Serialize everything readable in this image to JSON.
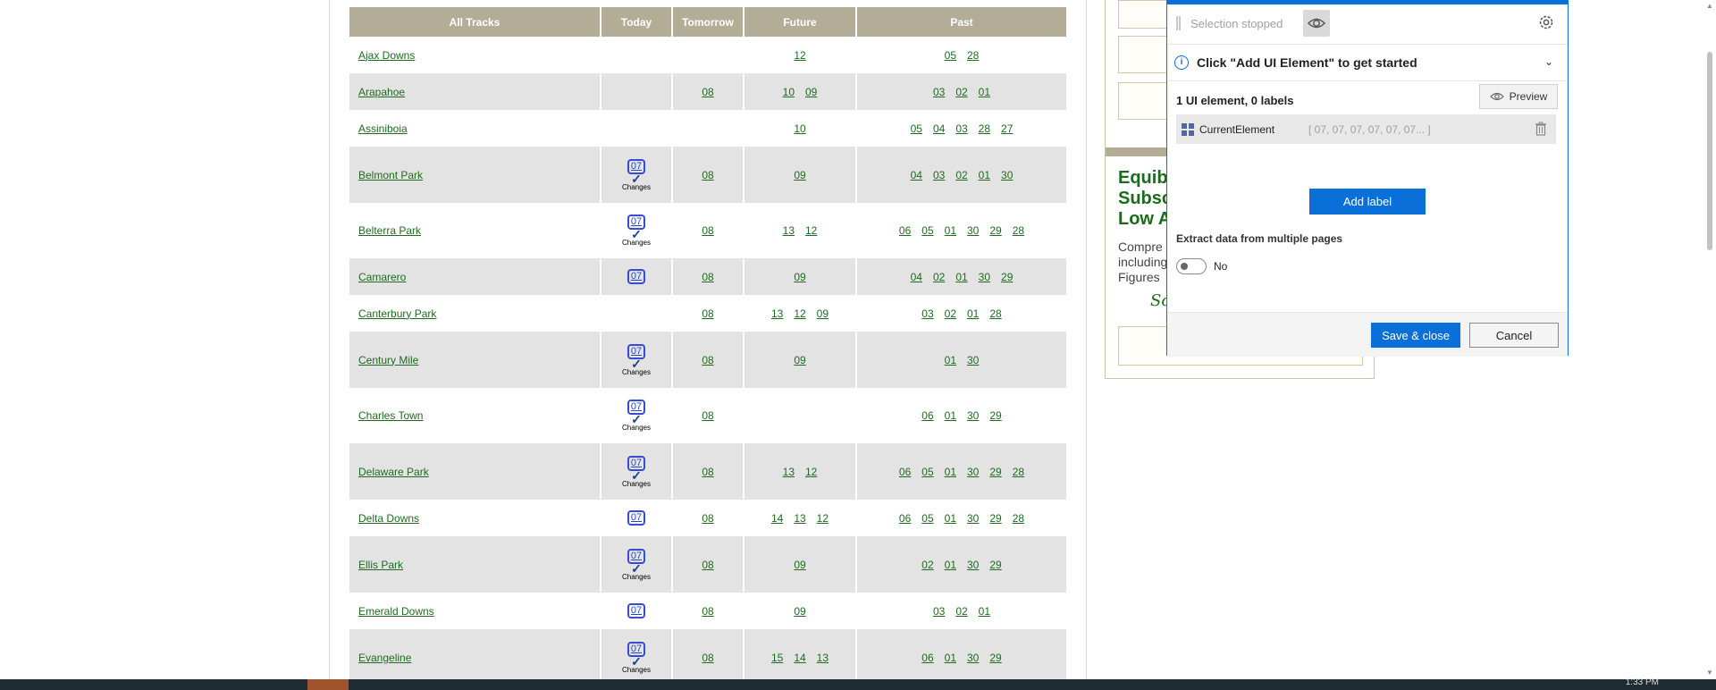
{
  "table": {
    "headers": [
      "All Tracks",
      "Today",
      "Tomorrow",
      "Future",
      "Past"
    ],
    "rows": [
      {
        "track": "Ajax Downs",
        "today": "",
        "today_changes": false,
        "tomorrow": [],
        "future": [
          "12"
        ],
        "past": [
          "05",
          "28"
        ],
        "height": 41,
        "shade": false
      },
      {
        "track": "Arapahoe",
        "today": "",
        "today_changes": false,
        "tomorrow": [
          "08"
        ],
        "future": [
          "10",
          "09"
        ],
        "past": [
          "03",
          "02",
          "01"
        ],
        "height": 41,
        "shade": true
      },
      {
        "track": "Assiniboia",
        "today": "",
        "today_changes": false,
        "tomorrow": [],
        "future": [
          "10"
        ],
        "past": [
          "05",
          "04",
          "03",
          "28",
          "27"
        ],
        "height": 41,
        "shade": false
      },
      {
        "track": "Belmont Park",
        "today": "07",
        "today_changes": true,
        "tomorrow": [
          "08"
        ],
        "future": [
          "09"
        ],
        "past": [
          "04",
          "03",
          "02",
          "01",
          "30"
        ],
        "height": 63,
        "shade": true
      },
      {
        "track": "Belterra Park",
        "today": "07",
        "today_changes": true,
        "tomorrow": [
          "08"
        ],
        "future": [
          "13",
          "12"
        ],
        "past": [
          "06",
          "05",
          "01",
          "30",
          "29",
          "28"
        ],
        "height": 62,
        "shade": false
      },
      {
        "track": "Camarero",
        "today": "07",
        "today_changes": false,
        "tomorrow": [
          "08"
        ],
        "future": [
          "09"
        ],
        "past": [
          "04",
          "02",
          "01",
          "30",
          "29"
        ],
        "height": 41,
        "shade": true
      },
      {
        "track": "Canterbury Park",
        "today": "",
        "today_changes": false,
        "tomorrow": [
          "08"
        ],
        "future": [
          "13",
          "12",
          "09"
        ],
        "past": [
          "03",
          "02",
          "01",
          "28"
        ],
        "height": 41,
        "shade": false
      },
      {
        "track": "Century Mile",
        "today": "07",
        "today_changes": true,
        "tomorrow": [
          "08"
        ],
        "future": [
          "09"
        ],
        "past": [
          "01",
          "30"
        ],
        "height": 63,
        "shade": true
      },
      {
        "track": "Charles Town",
        "today": "07",
        "today_changes": true,
        "tomorrow": [
          "08"
        ],
        "future": [],
        "past": [
          "06",
          "01",
          "30",
          "29"
        ],
        "height": 62,
        "shade": false
      },
      {
        "track": "Delaware Park",
        "today": "07",
        "today_changes": true,
        "tomorrow": [
          "08"
        ],
        "future": [
          "13",
          "12"
        ],
        "past": [
          "06",
          "05",
          "01",
          "30",
          "29",
          "28"
        ],
        "height": 63,
        "shade": true
      },
      {
        "track": "Delta Downs",
        "today": "07",
        "today_changes": false,
        "tomorrow": [
          "08"
        ],
        "future": [
          "14",
          "13",
          "12"
        ],
        "past": [
          "06",
          "05",
          "01",
          "30",
          "29",
          "28"
        ],
        "height": 41,
        "shade": false
      },
      {
        "track": "Ellis Park",
        "today": "07",
        "today_changes": true,
        "tomorrow": [
          "08"
        ],
        "future": [
          "09"
        ],
        "past": [
          "02",
          "01",
          "30",
          "29"
        ],
        "height": 63,
        "shade": true
      },
      {
        "track": "Emerald Downs",
        "today": "07",
        "today_changes": false,
        "tomorrow": [
          "08"
        ],
        "future": [
          "09"
        ],
        "past": [
          "03",
          "02",
          "01"
        ],
        "height": 41,
        "shade": false
      },
      {
        "track": "Evangeline",
        "today": "07",
        "today_changes": true,
        "tomorrow": [
          "08"
        ],
        "future": [
          "15",
          "14",
          "13"
        ],
        "past": [
          "06",
          "01",
          "30",
          "29"
        ],
        "height": 63,
        "shade": true
      }
    ],
    "changes_label": "Changes"
  },
  "ad": {
    "headline": "Equib\nSubsc\nLow A",
    "body": "Compre\nincluding\nFigures",
    "script_text": "Sc"
  },
  "dialog": {
    "selection_status": "Selection stopped",
    "info_text": "Click \"Add UI Element\" to get started",
    "count_text": "1 UI element, 0 labels",
    "preview_label": "Preview",
    "element_name": "CurrentElement",
    "element_value": "[ 07, 07, 07, 07, 07, 07... ]",
    "add_label": "Add label",
    "extract_text": "Extract data from multiple pages",
    "toggle_text": "No",
    "save_label": "Save & close",
    "cancel_label": "Cancel"
  },
  "taskbar": {
    "time": "1:33 PM"
  },
  "icons": {
    "info": "info-icon",
    "eye": "eye-icon",
    "gear": "gear-icon",
    "chevron": "chevron-down-icon",
    "trash": "trash-icon",
    "element": "ui-element-icon"
  },
  "colors": {
    "header_bg": "#b3ad98",
    "link": "#1f6b1f",
    "accent": "#0a6fd8",
    "row_shade": "#e3e3e3"
  }
}
